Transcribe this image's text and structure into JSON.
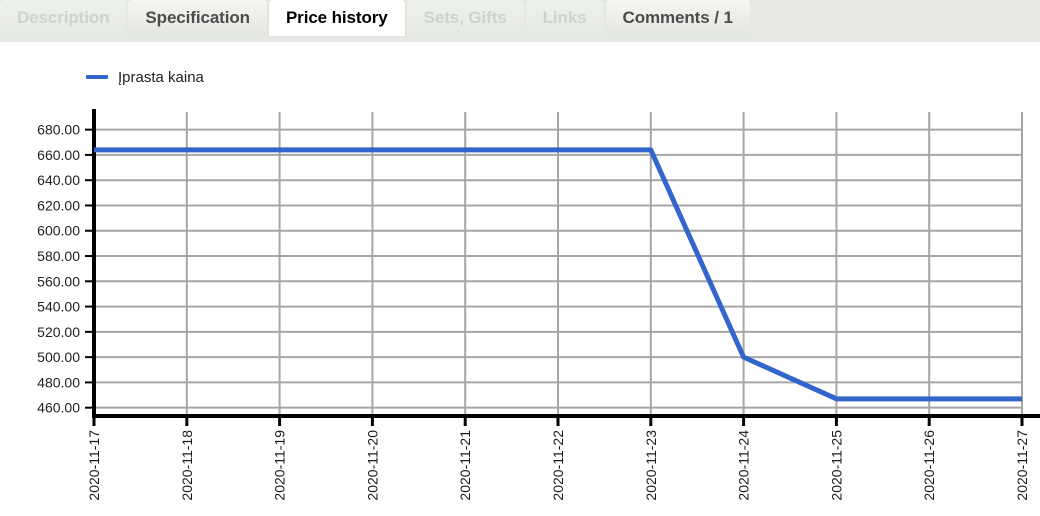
{
  "tabs": [
    {
      "label": "Description",
      "state": "disabled",
      "name": "tab-description"
    },
    {
      "label": "Specification",
      "state": "normal",
      "name": "tab-specification"
    },
    {
      "label": "Price history",
      "state": "active",
      "name": "tab-price-history"
    },
    {
      "label": "Sets, Gifts",
      "state": "disabled",
      "name": "tab-sets-gifts"
    },
    {
      "label": "Links",
      "state": "disabled",
      "name": "tab-links"
    },
    {
      "label": "Comments / 1",
      "state": "normal",
      "name": "tab-comments"
    }
  ],
  "legend": {
    "label": "Įprasta kaina",
    "color": "#3366cc"
  },
  "colors": {
    "line": "#3366cc",
    "gridline": "#a6a6a6",
    "axis": "#000000",
    "tab_bar_bg": "#e5e8e3",
    "tab_active_bg": "#ffffff",
    "tab_disabled_text": "#cfd3cc",
    "tab_text": "#4c4c4c",
    "plot_bg": "#ffffff"
  },
  "chart_data": {
    "type": "line",
    "title": "",
    "xlabel": "",
    "ylabel": "",
    "grid": true,
    "legend_position": "top-left",
    "categories": [
      "2020-11-17",
      "2020-11-18",
      "2020-11-19",
      "2020-11-20",
      "2020-11-21",
      "2020-11-22",
      "2020-11-23",
      "2020-11-24",
      "2020-11-25",
      "2020-11-26",
      "2020-11-27"
    ],
    "series": [
      {
        "name": "Įprasta kaina",
        "color": "#3366cc",
        "values": [
          664,
          664,
          664,
          664,
          664,
          664,
          664,
          500,
          467,
          467,
          467
        ]
      }
    ],
    "ylim": [
      455,
      690
    ],
    "ytick_values": [
      680,
      660,
      640,
      620,
      600,
      580,
      560,
      540,
      520,
      500,
      480,
      460
    ],
    "ytick_labels": [
      "680.00",
      "660.00",
      "640.00",
      "620.00",
      "600.00",
      "580.00",
      "560.00",
      "540.00",
      "520.00",
      "500.00",
      "480.00",
      "460.00"
    ],
    "xtick_labels": [
      "2020-11-17",
      "2020-11-18",
      "2020-11-19",
      "2020-11-20",
      "2020-11-21",
      "2020-11-22",
      "2020-11-23",
      "2020-11-24",
      "2020-11-25",
      "2020-11-26",
      "2020-11-27"
    ]
  }
}
